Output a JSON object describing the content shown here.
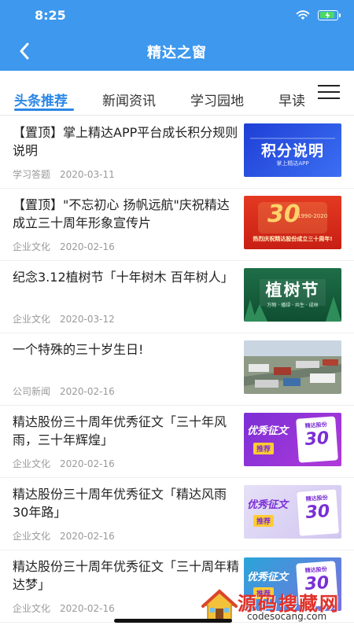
{
  "status": {
    "time": "8:25"
  },
  "nav": {
    "title": "精达之窗"
  },
  "tabs": [
    {
      "label": "头条推荐"
    },
    {
      "label": "新闻资讯"
    },
    {
      "label": "学习园地"
    },
    {
      "label": "早读"
    }
  ],
  "articles": [
    {
      "title": "【置顶】掌上精达APP平台成长积分规则说明",
      "category": "学习答题",
      "date": "2020-03-11",
      "thumb": {
        "main": "积分说明",
        "sub": "掌上精达APP"
      }
    },
    {
      "title": "【置顶】\"不忘初心  扬帆远航\"庆祝精达成立三十周年形象宣传片",
      "category": "企业文化",
      "date": "2020-02-16",
      "thumb": {
        "num": "30",
        "years": "1990-2020",
        "banner": "热烈庆祝精达股份成立三十周年!"
      }
    },
    {
      "title": "纪念3.12植树节「十年树木  百年树人」",
      "category": "企业文化",
      "date": "2020-03-12",
      "thumb": {
        "main": "植树节",
        "sub": "万物 · 播绿  · 共生  · 成林"
      }
    },
    {
      "title": "一个特殊的三十岁生日!",
      "category": "公司新闻",
      "date": "2020-02-16",
      "thumb": {}
    },
    {
      "title": "精达股份三十周年优秀征文「三十年风雨，三十年辉煌」",
      "category": "企业文化",
      "date": "2020-02-16",
      "thumb": {
        "main": "优秀征文",
        "tag": "推荐",
        "card": "精达股份",
        "num": "30"
      }
    },
    {
      "title": "精达股份三十周年优秀征文「精达风雨30年路」",
      "category": "企业文化",
      "date": "2020-02-16",
      "thumb": {
        "main": "优秀征文",
        "tag": "推荐",
        "card": "精达股份",
        "num": "30"
      }
    },
    {
      "title": "精达股份三十周年优秀征文「三十周年精达梦」",
      "category": "企业文化",
      "date": "2020-02-16",
      "thumb": {
        "main": "优秀征文",
        "tag": "推荐",
        "card": "精达股份",
        "num": "30"
      }
    }
  ],
  "watermark": {
    "text": "源码搜藏网",
    "url": "codesocang.com"
  }
}
